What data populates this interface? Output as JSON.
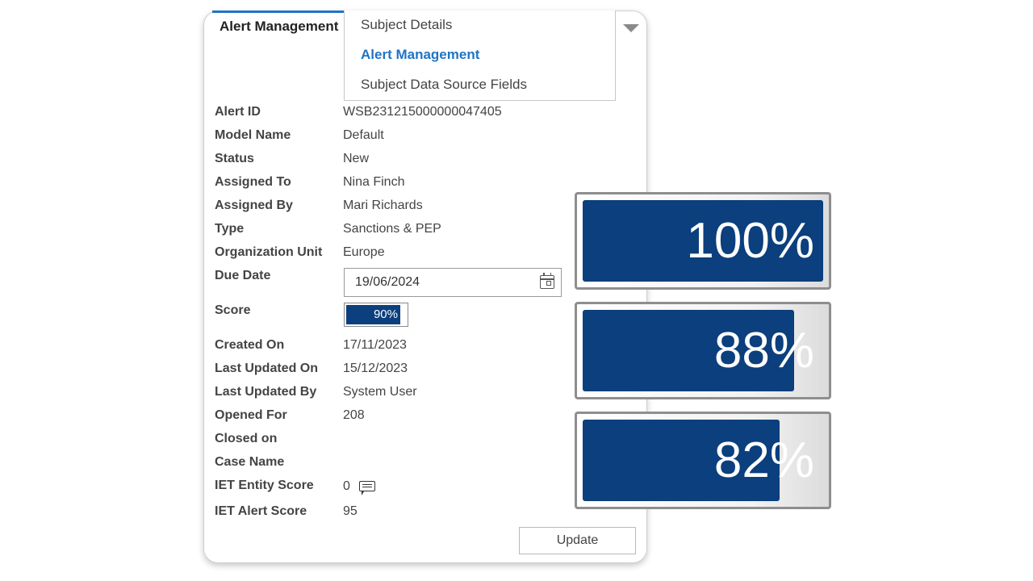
{
  "panel": {
    "active_tab": "Alert Management",
    "dropdown": {
      "items": [
        {
          "label": "Subject Details",
          "selected": false
        },
        {
          "label": "Alert Management",
          "selected": true
        },
        {
          "label": "Subject Data Source Fields",
          "selected": false
        }
      ]
    },
    "fields": {
      "alert_id": {
        "label": "Alert ID",
        "value": "WSB231215000000047405"
      },
      "model_name": {
        "label": "Model Name",
        "value": "Default"
      },
      "status": {
        "label": "Status",
        "value": "New"
      },
      "assigned_to": {
        "label": "Assigned To",
        "value": "Nina Finch"
      },
      "assigned_by": {
        "label": "Assigned By",
        "value": "Mari Richards"
      },
      "type": {
        "label": "Type",
        "value": "Sanctions & PEP"
      },
      "org_unit": {
        "label": "Organization Unit",
        "value": "Europe"
      },
      "due_date": {
        "label": "Due Date",
        "value": "19/06/2024"
      },
      "score": {
        "label": "Score",
        "value": "90%",
        "fraction": 0.9
      },
      "created_on": {
        "label": "Created On",
        "value": "17/11/2023"
      },
      "last_updated_on": {
        "label": "Last Updated On",
        "value": "15/12/2023"
      },
      "last_updated_by": {
        "label": "Last Updated By",
        "value": "System User"
      },
      "opened_for": {
        "label": "Opened For",
        "value": "208"
      },
      "closed_on": {
        "label": "Closed on",
        "value": ""
      },
      "case_name": {
        "label": "Case Name",
        "value": ""
      },
      "iet_entity_score": {
        "label": "IET Entity Score",
        "value": "0"
      },
      "iet_alert_score": {
        "label": "IET Alert Score",
        "value": "95"
      }
    },
    "update_label": "Update"
  },
  "score_badges": [
    {
      "label": "100%",
      "fraction": 1.0
    },
    {
      "label": "88%",
      "fraction": 0.88
    },
    {
      "label": "82%",
      "fraction": 0.82
    }
  ],
  "colors": {
    "accent": "#1f74c6",
    "score_fill": "#0b3f7d"
  },
  "icons": {
    "dropdown": "chevron-down-icon",
    "date": "calendar-icon",
    "entity_score": "comment-icon"
  }
}
